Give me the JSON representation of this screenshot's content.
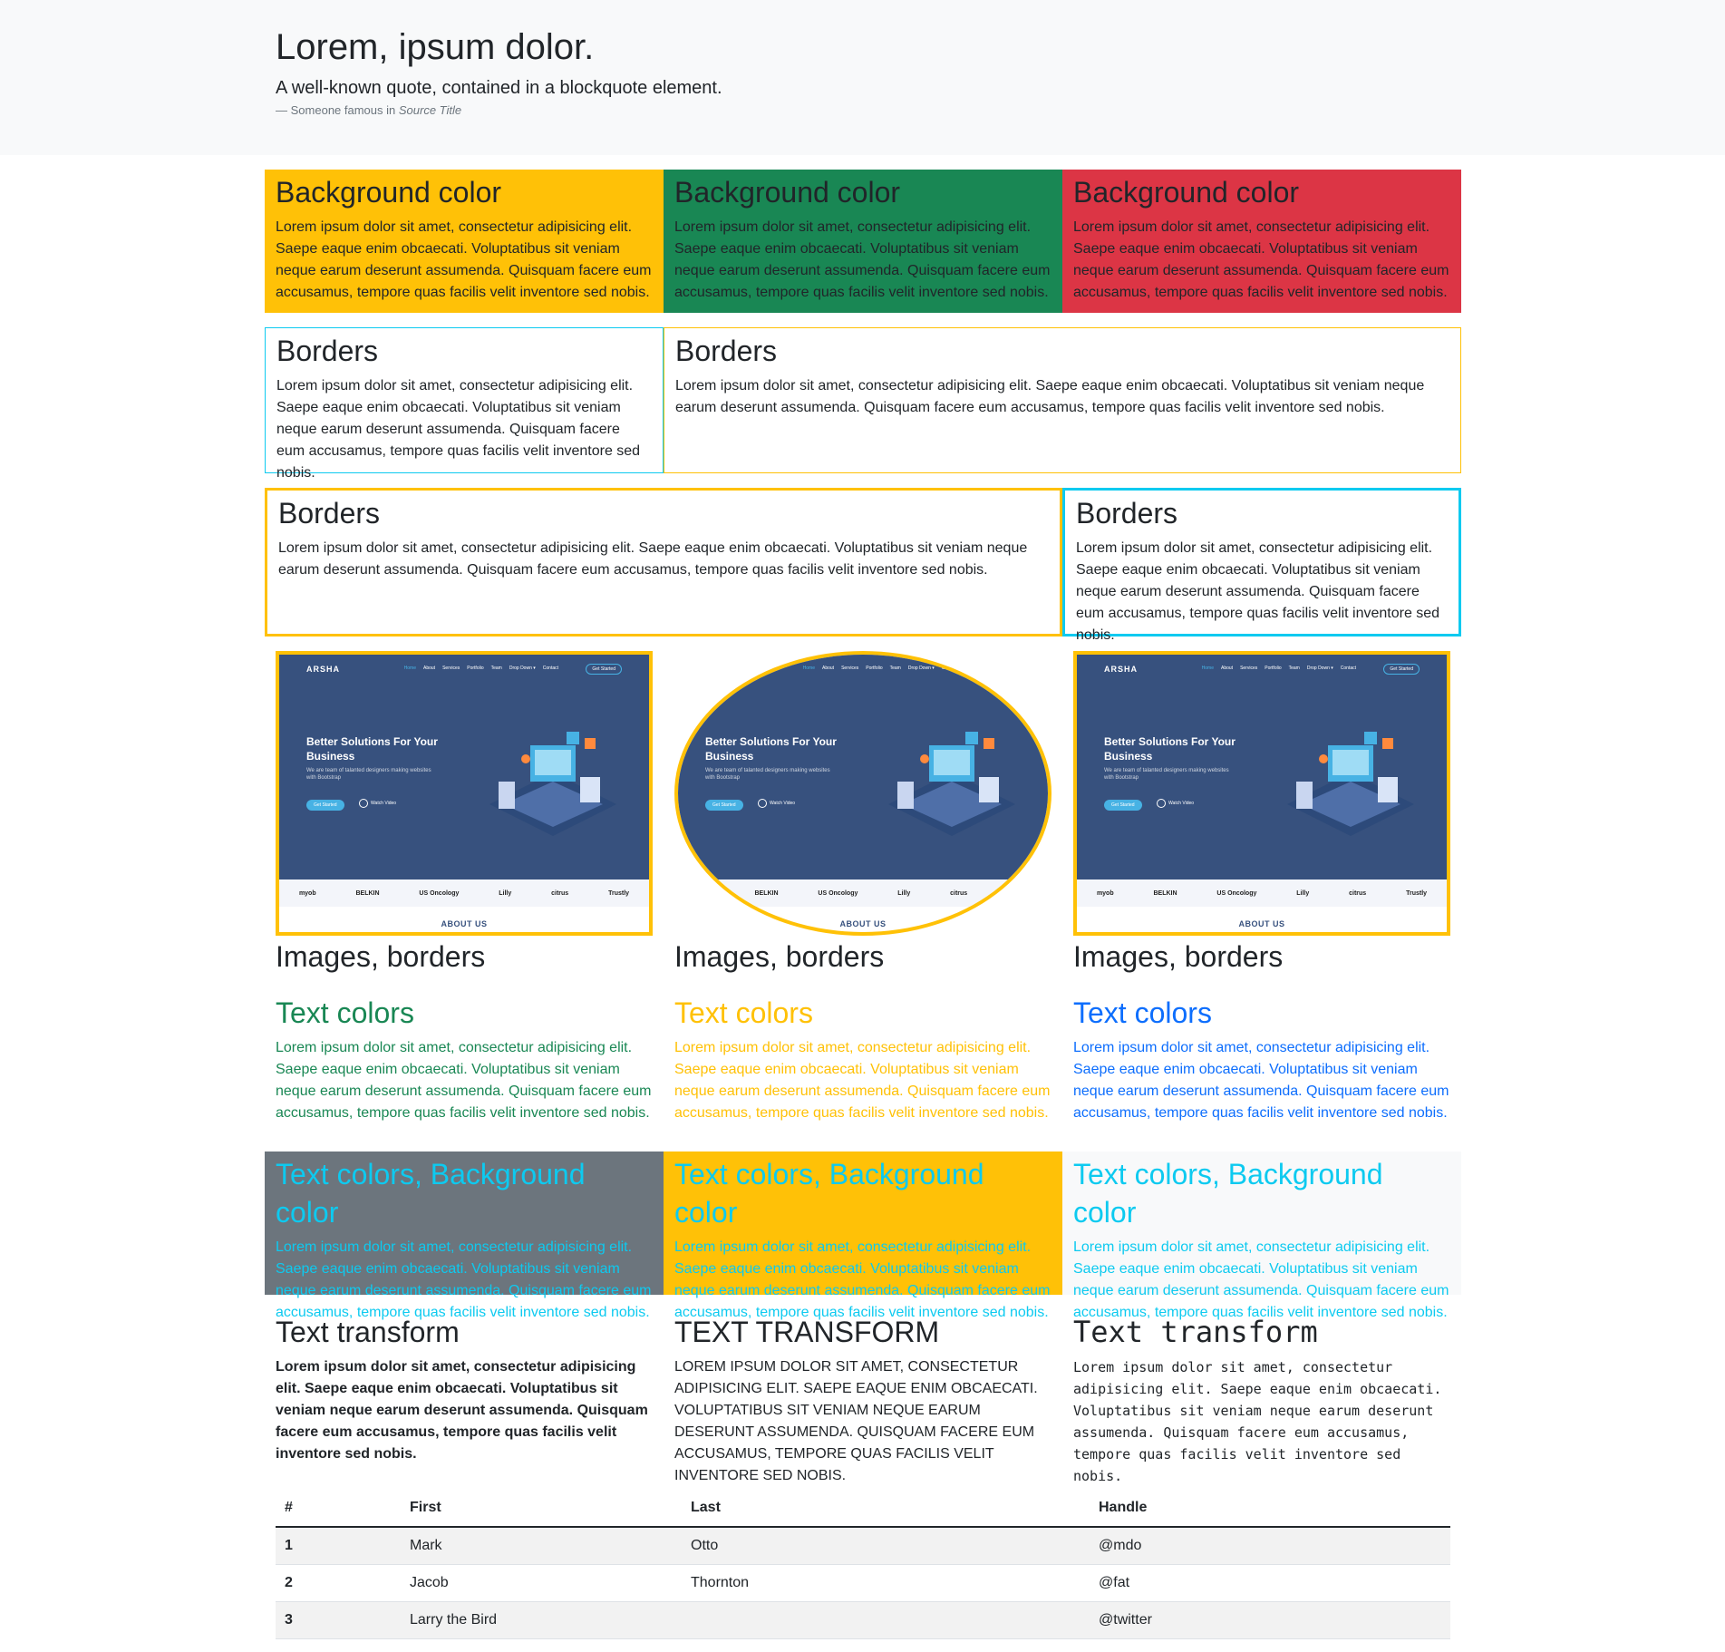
{
  "hero": {
    "title": "Lorem, ipsum dolor.",
    "quote": "A well-known quote, contained in a blockquote element.",
    "dash": "— ",
    "attribution": "Someone famous in ",
    "source": "Source Title"
  },
  "lorem": "Lorem ipsum dolor sit amet, consectetur adipisicing elit. Saepe eaque enim obcaecati. Voluptatibus sit veniam neque earum deserunt assumenda. Quisquam facere eum accusamus, tempore quas facilis velit inventore sed nobis.",
  "bg_section": {
    "cards": [
      {
        "title": "Background color",
        "color": "#ffc107"
      },
      {
        "title": "Background color",
        "color": "#198754"
      },
      {
        "title": "Background color",
        "color": "#dc3545"
      }
    ]
  },
  "borders_row1": [
    {
      "title": "Borders"
    },
    {
      "title": "Borders"
    }
  ],
  "borders_row2": [
    {
      "title": "Borders"
    },
    {
      "title": "Borders"
    }
  ],
  "images": {
    "screenshot": {
      "brand": "ARSHA",
      "nav": [
        "Home",
        "About",
        "Services",
        "Portfolio",
        "Team",
        "Drop Down ▾",
        "Contact"
      ],
      "cta": "Get Started",
      "headline": "Better Solutions For Your Business",
      "subline": "We are team of talanted designers making websites with Bootstrap",
      "primary_button": "Get Started",
      "secondary_button": "Watch Video",
      "logos": [
        "myob",
        "BELKIN",
        "US Oncology",
        "Lilly",
        "citrus",
        "Trustly"
      ],
      "section": "ABOUT US"
    },
    "captions": [
      "Images, borders",
      "Images, borders",
      "Images, borders"
    ]
  },
  "text_colors": {
    "cards": [
      {
        "title": "Text colors",
        "color": "#198754"
      },
      {
        "title": "Text colors",
        "color": "#ffc107"
      },
      {
        "title": "Text colors",
        "color": "#0d6efd"
      }
    ]
  },
  "text_bg": {
    "cards": [
      {
        "title": "Text colors, Background color",
        "text_color": "#0dcaf0",
        "bg": "#6c757d"
      },
      {
        "title": "Text colors, Background color",
        "text_color": "#0dcaf0",
        "bg": "#ffc107"
      },
      {
        "title": "Text colors, Background color",
        "text_color": "#0dcaf0",
        "bg": "#f8f9fa"
      }
    ]
  },
  "transform": {
    "titles": [
      "Text transform",
      "Text transform",
      "Text transform"
    ]
  },
  "table": {
    "headers": [
      "#",
      "First",
      "Last",
      "Handle"
    ],
    "rows": [
      [
        "1",
        "Mark",
        "Otto",
        "@mdo"
      ],
      [
        "2",
        "Jacob",
        "Thornton",
        "@fat"
      ],
      [
        "3",
        "Larry the Bird",
        "",
        "@twitter"
      ]
    ]
  }
}
